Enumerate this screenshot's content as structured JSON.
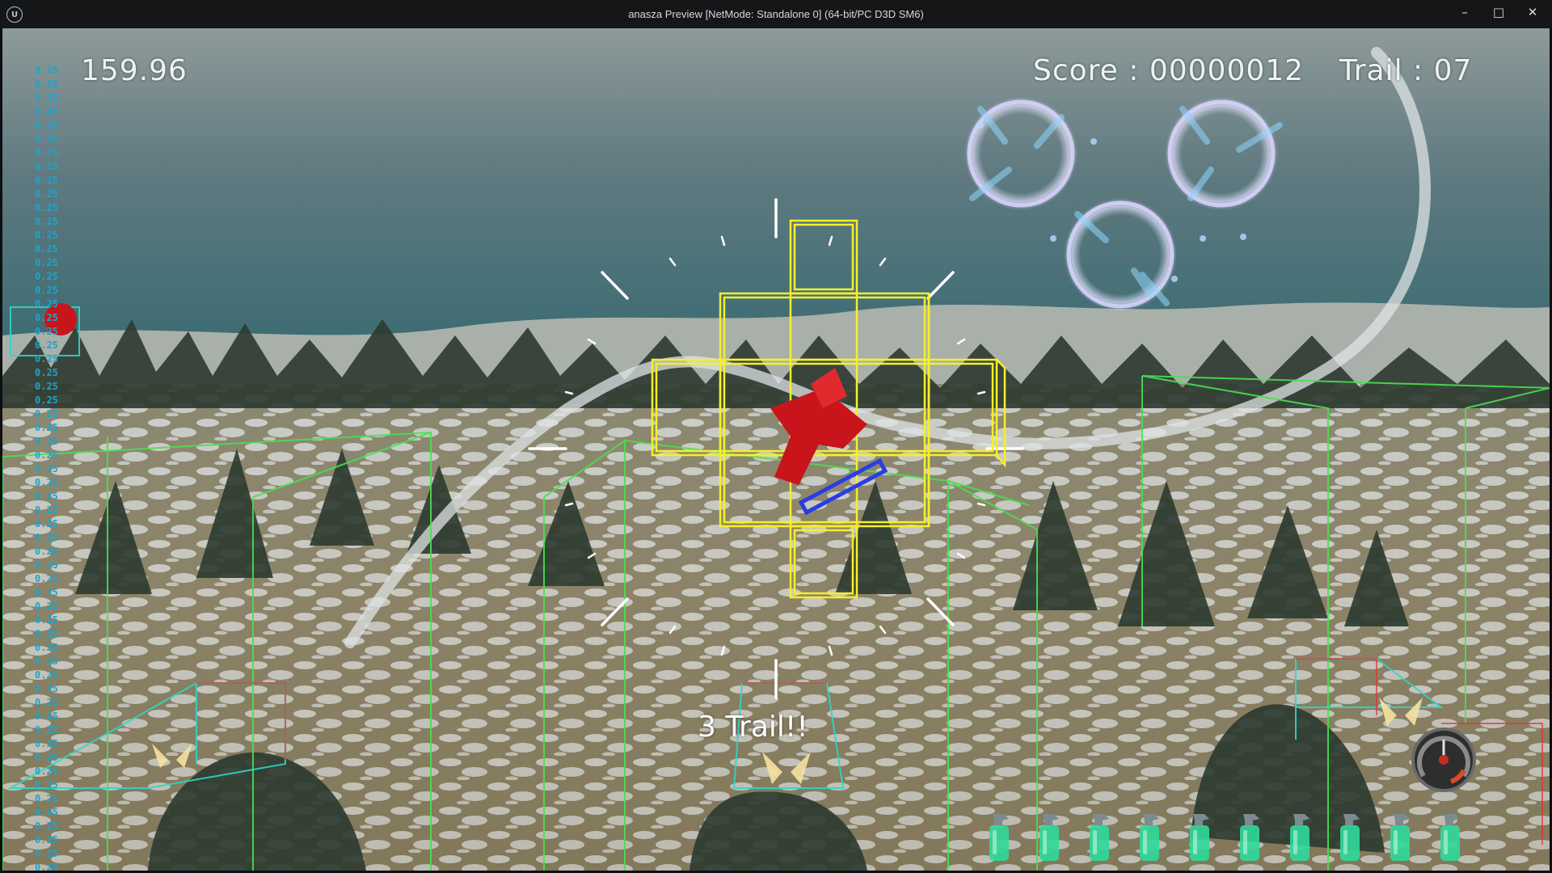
{
  "window": {
    "title": "anasza Preview [NetMode: Standalone 0]  (64-bit/PC D3D SM6)",
    "app_icon_glyph": "U",
    "minimize_glyph": "–",
    "maximize_glyph": "□",
    "close_glyph": "✕"
  },
  "hud": {
    "timer": "159.96",
    "score": "Score : 00000012",
    "trail": "Trail : 07",
    "trail_popup": "3 Trail!!"
  },
  "debug_values": [
    "0.25",
    "0.25",
    "0.25",
    "0.25",
    "0.25",
    "0.25",
    "0.25",
    "0.25",
    "0.25",
    "0.25",
    "0.25",
    "0.25",
    "0.25",
    "0.25",
    "0.25",
    "0.25",
    "0.25",
    "0.25",
    "0.25",
    "0.25",
    "0.25",
    "0.25",
    "0.25",
    "0.25",
    "0.25",
    "0.25",
    "0.25",
    "0.25",
    "0.25",
    "0.25",
    "0.25",
    "0.25",
    "0.25",
    "0.25",
    "0.25",
    "0.25",
    "0.25",
    "0.25",
    "0.25",
    "0.25",
    "0.25",
    "0.25",
    "0.25",
    "0.25",
    "0.25",
    "0.25",
    "0.25",
    "0.25",
    "0.25",
    "0.25",
    "0.25",
    "0.25",
    "0.25",
    "0.25",
    "0.25",
    "0.25",
    "0.25",
    "0.25",
    "0.25"
  ],
  "inventory": {
    "spray_bottle_count": 10,
    "icon": "spray-bottle-icon"
  },
  "colors": {
    "hud_text": "#eef2f2",
    "debug_text": "#1ea4c8",
    "wireframe": "#f6ef2a",
    "bounds_green": "#48e050",
    "bounds_cyan": "#2fd6c8",
    "bounds_red": "#e03030",
    "plane": "#c8141a",
    "spray_liquid": "#2fd99a"
  }
}
